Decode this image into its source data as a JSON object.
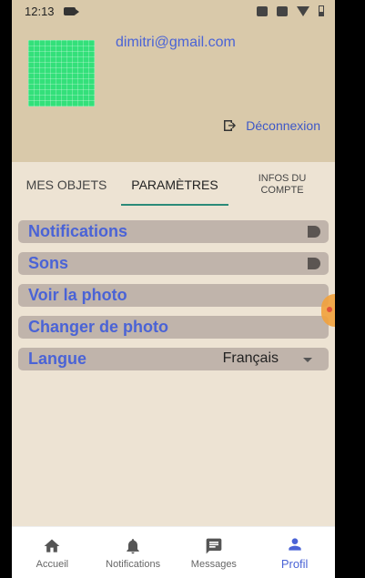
{
  "status_bar": {
    "time": "12:13"
  },
  "header": {
    "email": "dimitri@gmail.com",
    "logout_label": "Déconnexion"
  },
  "tabs": [
    {
      "label": "MES OBJETS"
    },
    {
      "label": "PARAMÈTRES",
      "active": true
    },
    {
      "label": "INFOS DU\nCOMPTE"
    }
  ],
  "settings": {
    "notifications": "Notifications",
    "sounds": "Sons",
    "view_photo": "Voir la photo",
    "change_photo": "Changer de photo",
    "language_label": "Langue",
    "language_value": "Français"
  },
  "bottom_nav": [
    {
      "label": "Accueil",
      "icon": "home-icon"
    },
    {
      "label": "Notifications",
      "icon": "bell-icon"
    },
    {
      "label": "Messages",
      "icon": "message-icon"
    },
    {
      "label": "Profil",
      "icon": "person-icon",
      "active": true
    }
  ],
  "colors": {
    "header_bg": "#d9c9aa",
    "accent_blue": "#4a63d6",
    "tab_indicator": "#2a8a78",
    "avatar_green": "#33e07a"
  }
}
